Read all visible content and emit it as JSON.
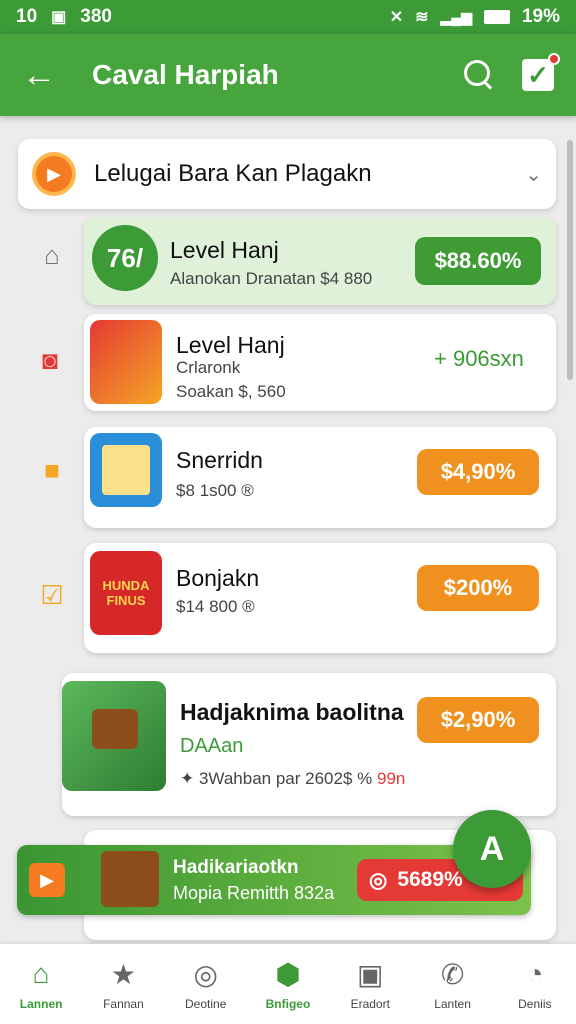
{
  "status_bar": {
    "left_time": "10",
    "left_num": "380",
    "battery": "19%"
  },
  "app_bar": {
    "title": "Caval Harpiah",
    "back_icon": "arrow-left-icon",
    "search_icon": "search-icon",
    "check_icon": "checkbox-icon"
  },
  "dropdown": {
    "label": "Lelugai Bara Kan Plagakn",
    "icon": "chevron-down-icon"
  },
  "items": [
    {
      "badge": "76/",
      "name": "Level Hanj",
      "sub1": "Alanokan Dranatan $4 880",
      "sub2": "",
      "price": "$88.60%",
      "price_style": "green"
    },
    {
      "name": "Level Hanj",
      "sub1": "Crlaronk",
      "sub2": "Soakan $, 560",
      "price": "+ 906sxn",
      "price_style": "text"
    },
    {
      "name": "Snerridn",
      "sub1": "$8 1s00 ®",
      "sub2": "",
      "price": "$4,90%",
      "price_style": "orange"
    },
    {
      "name": "Bonjakn",
      "sub1": "$14 800 ®",
      "sub2": "",
      "price": "$200%",
      "price_style": "orange",
      "thumb_text": "HUNDA FINUS"
    },
    {
      "name": "Hadjaknima baolitna",
      "sub1": "DAAan",
      "sub2": "✦ 3Wahban par 2602$ %",
      "sub2_red": "99n",
      "price": "$2,90%",
      "price_style": "orange"
    }
  ],
  "fab": {
    "label": "A"
  },
  "banner": {
    "title": "Hadikariaotkn",
    "subtitle": "Mopia Remitth 832a",
    "price": "5689%"
  },
  "nav": [
    {
      "label": "Lannen",
      "icon": "home-icon",
      "active": true
    },
    {
      "label": "Fannan",
      "icon": "star-icon",
      "active": false
    },
    {
      "label": "Deotine",
      "icon": "compass-icon",
      "active": false
    },
    {
      "label": "Bnfigeo",
      "icon": "cube-icon",
      "active": true
    },
    {
      "label": "Eradort",
      "icon": "inbox-icon",
      "active": false
    },
    {
      "label": "Lanten",
      "icon": "phone-icon",
      "active": false
    },
    {
      "label": "Deniis",
      "icon": "gauge-icon",
      "active": false
    }
  ],
  "colors": {
    "primary": "#47a53e",
    "accent": "#f0901e",
    "green_pill": "#3f9c35"
  }
}
